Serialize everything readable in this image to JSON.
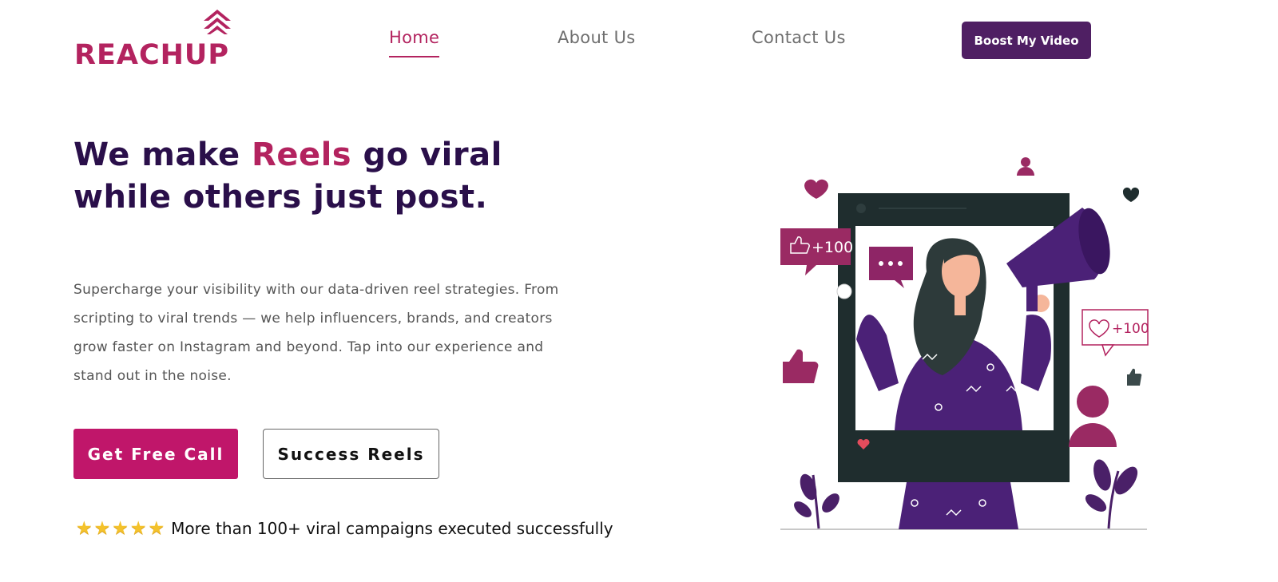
{
  "brand": {
    "name": "REACHUP",
    "accent": "#b3235f",
    "dark": "#2a0f4a"
  },
  "nav": {
    "items": [
      {
        "label": "Home",
        "active": true
      },
      {
        "label": "About Us",
        "active": false
      },
      {
        "label": "Contact Us",
        "active": false
      }
    ],
    "cta_label": "Boost My Video"
  },
  "hero": {
    "headline_before": "We make ",
    "headline_highlight": "Reels",
    "headline_after": " go viral while others just post.",
    "description": "Supercharge your visibility with our data-driven reel strategies. From scripting to viral trends — we help influencers, brands, and creators grow faster on Instagram and beyond. Tap into our experience and stand out in the noise.",
    "primary_button": "Get Free Call",
    "secondary_button": "Success Reels",
    "rating_stars": 5,
    "rating_text": "More than 100+ viral campaigns executed successfully"
  },
  "illustration": {
    "like_badge": "+100",
    "heart_badge": "+100",
    "icons": [
      "heart-icon",
      "user-icon",
      "thumbs-up-icon",
      "chat-bubble-icon",
      "megaphone-icon"
    ]
  }
}
